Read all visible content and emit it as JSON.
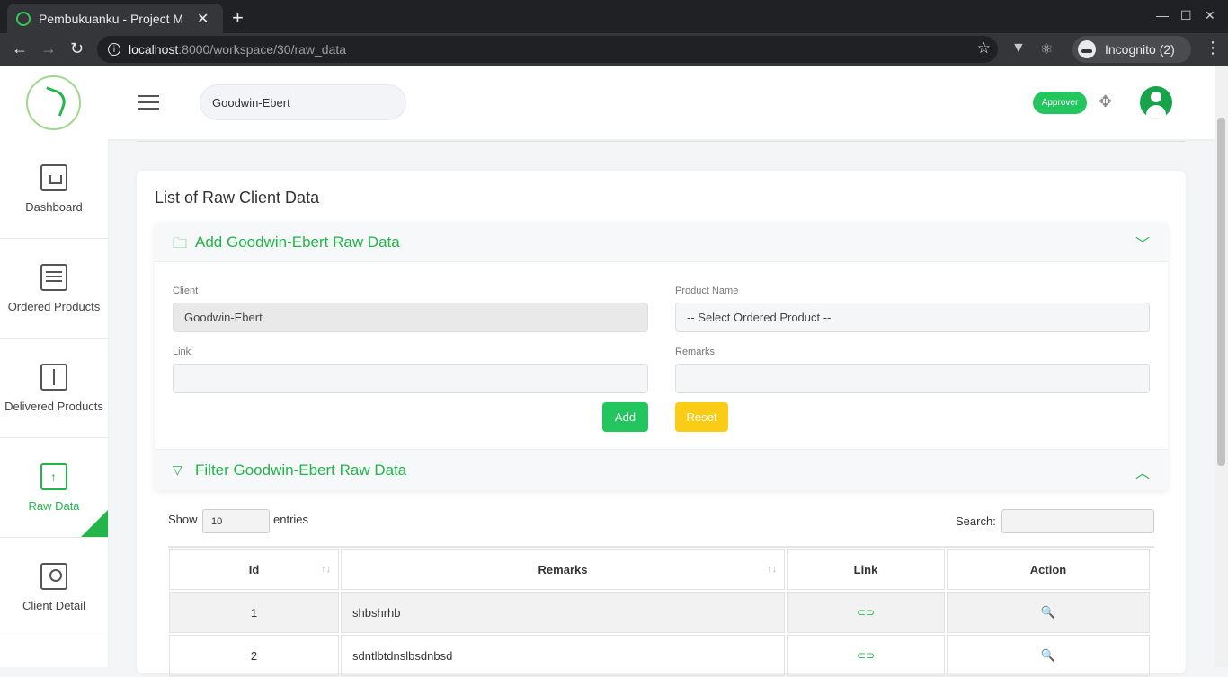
{
  "browser": {
    "tab_title": "Pembukuanku - Project M",
    "url_host": "localhost",
    "url_path": ":8000/workspace/30/raw_data",
    "incognito_label": "Incognito (2)"
  },
  "header": {
    "workspace_name": "Goodwin-Ebert",
    "role_badge": "Approver"
  },
  "sidebar": {
    "items": [
      {
        "label": "Dashboard",
        "icon": "dashboard-icon"
      },
      {
        "label": "Ordered Products",
        "icon": "ordered-products-icon"
      },
      {
        "label": "Delivered Products",
        "icon": "delivered-products-icon"
      },
      {
        "label": "Raw Data",
        "icon": "raw-data-icon",
        "active": true
      },
      {
        "label": "Client Detail",
        "icon": "client-detail-icon"
      }
    ]
  },
  "main": {
    "title": "List of Raw Client Data",
    "add_panel": {
      "title": "Add Goodwin-Ebert Raw Data",
      "client_label": "Client",
      "client_value": "Goodwin-Ebert",
      "product_label": "Product Name",
      "product_value": "-- Select Ordered Product --",
      "link_label": "Link",
      "remarks_label": "Remarks",
      "add_button": "Add",
      "reset_button": "Reset"
    },
    "filter_panel": {
      "title": "Filter Goodwin-Ebert Raw Data"
    },
    "table_controls": {
      "show_label": "Show",
      "length_value": "10",
      "entries_label": "entries",
      "search_label": "Search:"
    },
    "table": {
      "columns": [
        "Id",
        "Remarks",
        "Link",
        "Action"
      ],
      "rows": [
        {
          "id": "1",
          "remarks": "shbshrhb"
        },
        {
          "id": "2",
          "remarks": "sdntlbtdnslbsdnbsd"
        }
      ]
    }
  },
  "colors": {
    "accent": "#22b54a",
    "add_button": "#22c55e",
    "reset_button": "#facc15"
  }
}
